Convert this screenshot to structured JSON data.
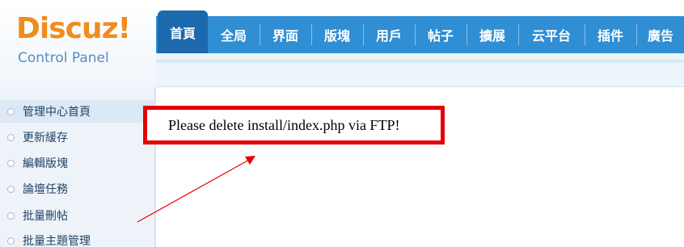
{
  "logo": {
    "brand": "Discuz!",
    "sub": "Control Panel"
  },
  "nav": {
    "tabs": [
      "首頁",
      "全局",
      "界面",
      "版塊",
      "用戶",
      "帖子",
      "擴展",
      "云平台",
      "插件",
      "廣告"
    ],
    "active_index": 0
  },
  "sidebar": {
    "items": [
      "管理中心首頁",
      "更新緩存",
      "編輯版塊",
      "論壇任務",
      "批量刪帖",
      "批量主題管理"
    ],
    "active_index": 0
  },
  "main": {
    "notice": "Please delete install/index.php via FTP!"
  },
  "colors": {
    "accent": "#2f8ed4",
    "active_tab": "#1c69ad",
    "highlight_border": "#e60000",
    "logo_orange": "#f08c1e"
  }
}
